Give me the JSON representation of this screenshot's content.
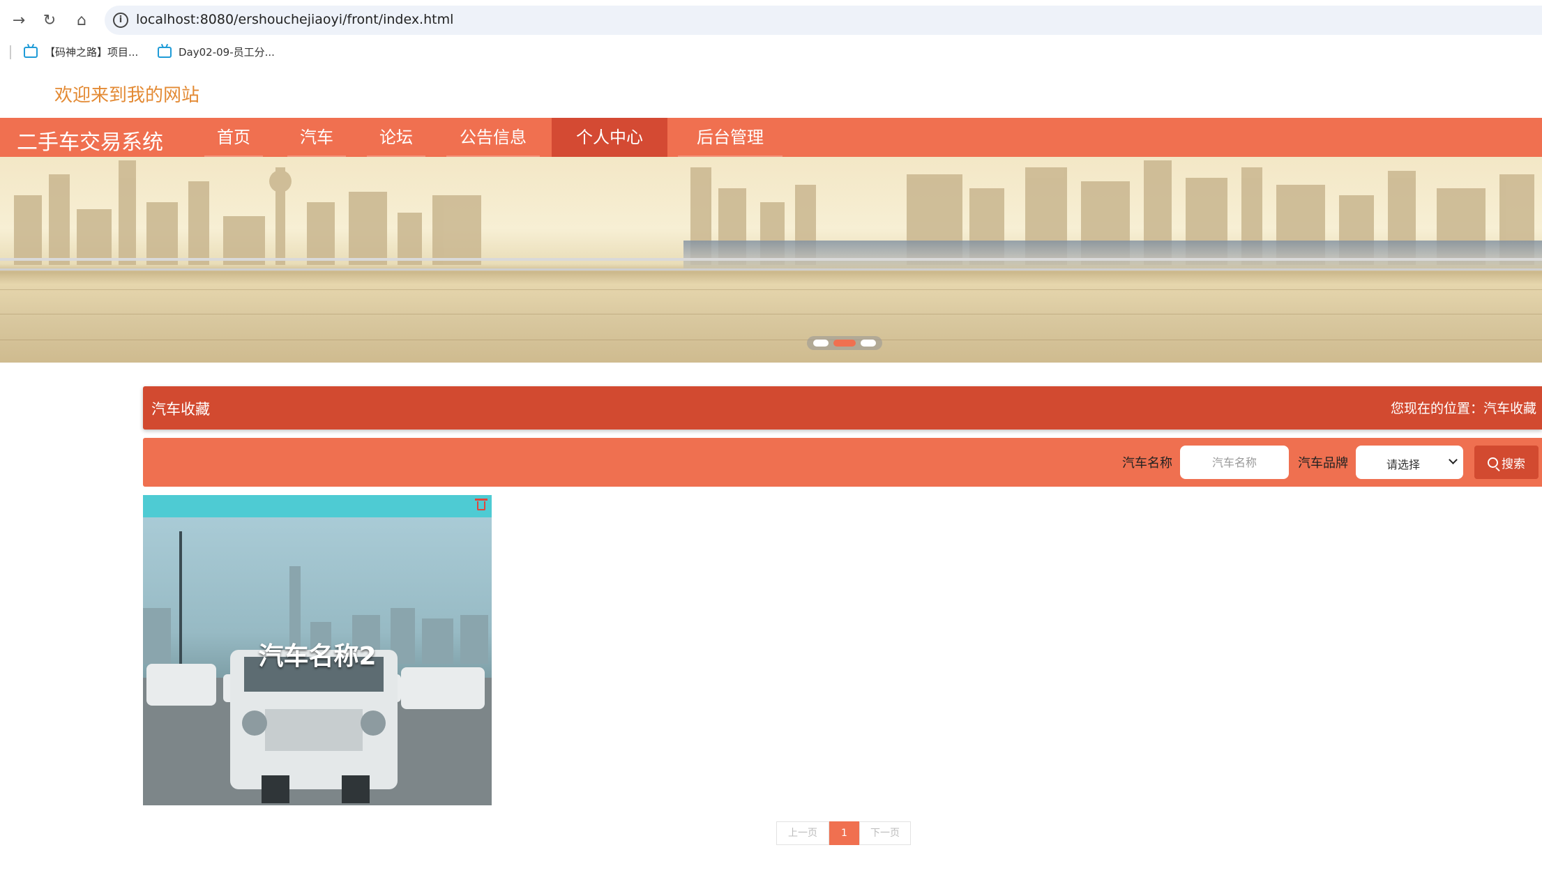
{
  "browser": {
    "url": "localhost:8080/ershouchejiaoyi/front/index.html",
    "bookmarks": [
      {
        "label": "【码神之路】项目..."
      },
      {
        "label": "Day02-09-员工分..."
      }
    ]
  },
  "site": {
    "welcome": "欢迎来到我的网站",
    "brand": "二手车交易系统",
    "nav": [
      {
        "label": "首页"
      },
      {
        "label": "汽车"
      },
      {
        "label": "论坛"
      },
      {
        "label": "公告信息"
      },
      {
        "label": "个人中心",
        "active": true
      },
      {
        "label": "后台管理"
      }
    ],
    "accent_color": "#f07050",
    "dark_accent_color": "#d24a30"
  },
  "banner": {
    "slides": 3,
    "active_slide": 2
  },
  "section": {
    "title": "汽车收藏",
    "location": "您现在的位置：汽车收藏"
  },
  "search": {
    "name_label": "汽车名称",
    "name_placeholder": "汽车名称",
    "brand_label": "汽车品牌",
    "brand_selected": "请选择",
    "button_label": "搜索",
    "button_icon": "search-icon"
  },
  "items": [
    {
      "name": "汽车名称2",
      "delete_icon": "trash-icon"
    }
  ],
  "pagination": {
    "prev_label": "上一页",
    "current_page": "1",
    "next_label": "下一页"
  }
}
